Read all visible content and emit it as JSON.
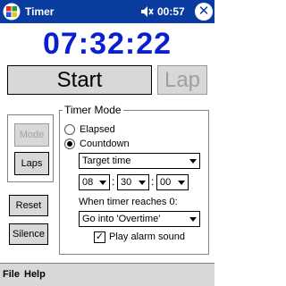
{
  "titlebar": {
    "title": "Timer",
    "time": "00:57",
    "icons": {
      "logo": "windows-flag-icon",
      "volume": "speaker-muted-icon",
      "close": "close-icon"
    },
    "close_glyph": "✕"
  },
  "display": {
    "time": "07:32:22"
  },
  "buttons": {
    "start": "Start",
    "lap": "Lap",
    "mode": "Mode",
    "laps": "Laps",
    "reset": "Reset",
    "silence": "Silence"
  },
  "timer_mode": {
    "label": "Timer Mode",
    "options": [
      "Elapsed",
      "Countdown"
    ],
    "selected": "Countdown",
    "target_select": "Target time",
    "hours": "08",
    "minutes": "30",
    "seconds": "00",
    "when_label": "When timer reaches 0:",
    "action_select": "Go into 'Overtime'",
    "alarm_label": "Play alarm sound",
    "alarm_checked": true,
    "check_glyph": "✓"
  },
  "menu": {
    "file": "File",
    "help": "Help"
  },
  "colors": {
    "titlebar": "#0a3b9e",
    "time": "#0a1fd0",
    "button_face": "#d8d8d8"
  }
}
